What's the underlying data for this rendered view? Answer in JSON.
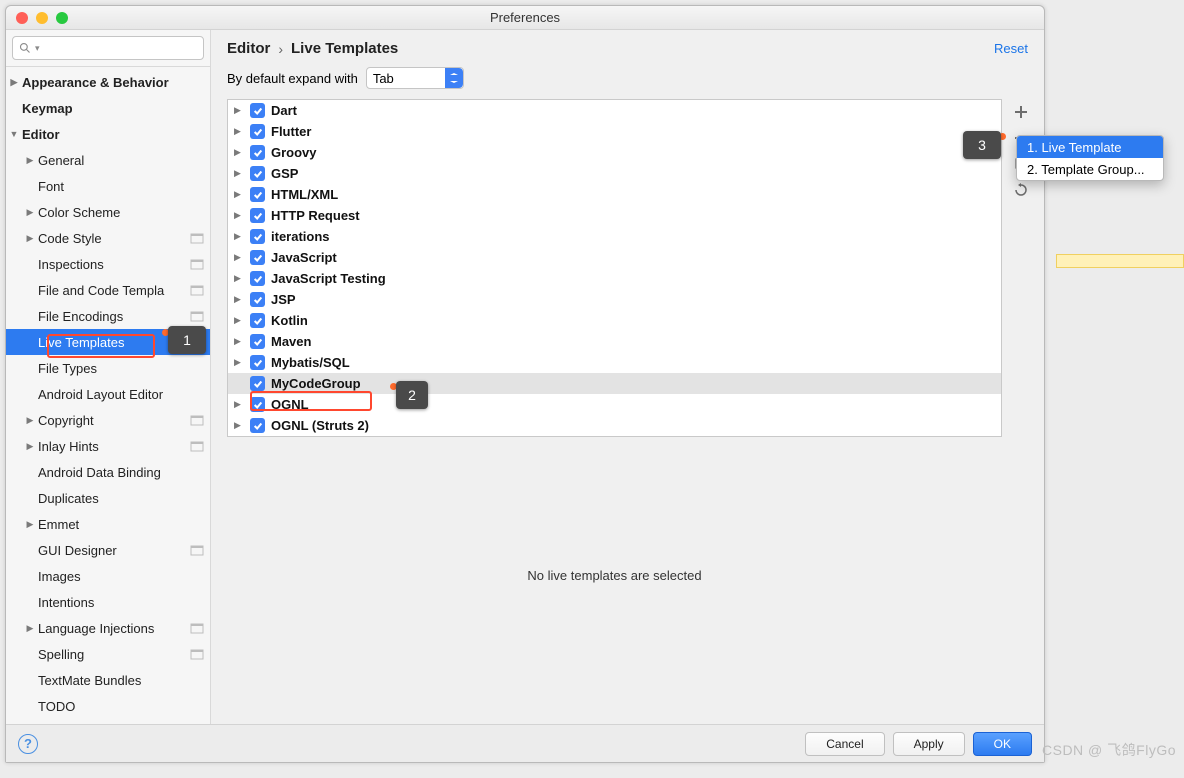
{
  "title": "Preferences",
  "breadcrumb": {
    "root": "Editor",
    "leaf": "Live Templates"
  },
  "reset_label": "Reset",
  "expand_row": {
    "label": "By default expand with",
    "value": "Tab"
  },
  "sidebar": {
    "items": [
      {
        "label": "Appearance & Behavior",
        "level": 0,
        "arrow": "collapsed"
      },
      {
        "label": "Keymap",
        "level": 0
      },
      {
        "label": "Editor",
        "level": 0,
        "arrow": "expanded"
      },
      {
        "label": "General",
        "level": 1,
        "arrow": "collapsed"
      },
      {
        "label": "Font",
        "level": 1
      },
      {
        "label": "Color Scheme",
        "level": 1,
        "arrow": "collapsed"
      },
      {
        "label": "Code Style",
        "level": 1,
        "arrow": "collapsed",
        "cfg": true
      },
      {
        "label": "Inspections",
        "level": 1,
        "cfg": true
      },
      {
        "label": "File and Code Templa",
        "level": 1,
        "cfg": true
      },
      {
        "label": "File Encodings",
        "level": 1,
        "cfg": true
      },
      {
        "label": "Live Templates",
        "level": 1,
        "cfg": true,
        "selected": true
      },
      {
        "label": "File Types",
        "level": 1
      },
      {
        "label": "Android Layout Editor",
        "level": 1
      },
      {
        "label": "Copyright",
        "level": 1,
        "arrow": "collapsed",
        "cfg": true
      },
      {
        "label": "Inlay Hints",
        "level": 1,
        "arrow": "collapsed",
        "cfg": true
      },
      {
        "label": "Android Data Binding",
        "level": 1
      },
      {
        "label": "Duplicates",
        "level": 1
      },
      {
        "label": "Emmet",
        "level": 1,
        "arrow": "collapsed"
      },
      {
        "label": "GUI Designer",
        "level": 1,
        "cfg": true
      },
      {
        "label": "Images",
        "level": 1
      },
      {
        "label": "Intentions",
        "level": 1
      },
      {
        "label": "Language Injections",
        "level": 1,
        "arrow": "collapsed",
        "cfg": true
      },
      {
        "label": "Spelling",
        "level": 1,
        "cfg": true
      },
      {
        "label": "TextMate Bundles",
        "level": 1
      },
      {
        "label": "TODO",
        "level": 1
      }
    ]
  },
  "groups": [
    {
      "name": "Dart"
    },
    {
      "name": "Flutter"
    },
    {
      "name": "Groovy"
    },
    {
      "name": "GSP"
    },
    {
      "name": "HTML/XML"
    },
    {
      "name": "HTTP Request"
    },
    {
      "name": "iterations"
    },
    {
      "name": "JavaScript"
    },
    {
      "name": "JavaScript Testing"
    },
    {
      "name": "JSP"
    },
    {
      "name": "Kotlin"
    },
    {
      "name": "Maven"
    },
    {
      "name": "Mybatis/SQL"
    },
    {
      "name": "MyCodeGroup",
      "selected": true,
      "noarrow": true
    },
    {
      "name": "OGNL"
    },
    {
      "name": "OGNL (Struts 2)"
    }
  ],
  "empty_msg": "No live templates are selected",
  "popup": {
    "item1": "1. Live Template",
    "item2": "2. Template Group..."
  },
  "buttons": {
    "cancel": "Cancel",
    "apply": "Apply",
    "ok": "OK"
  },
  "callouts": {
    "c1": "1",
    "c2": "2",
    "c3": "3"
  },
  "watermark": "CSDN @ 飞鸽FlyGo"
}
